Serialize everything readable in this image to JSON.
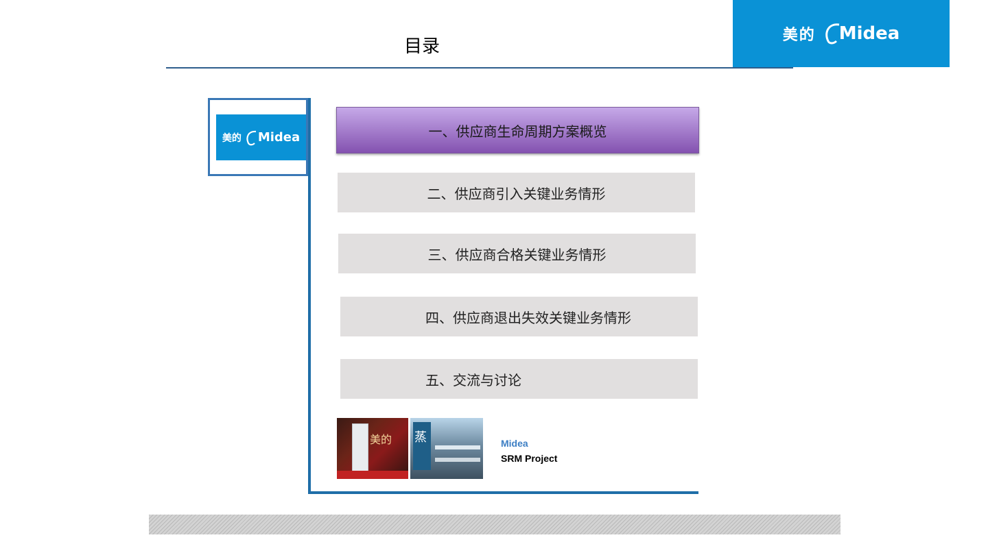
{
  "header": {
    "title": "目录",
    "brand_cn": "美的",
    "brand_en": "Midea",
    "brand_color": "#0a92d6"
  },
  "frame_logo": {
    "cn": "美的",
    "en": "Midea"
  },
  "menu": {
    "items": [
      {
        "label": "一、供应商生命周期方案概览",
        "active": true
      },
      {
        "label": "二、供应商引入关键业务情形",
        "active": false
      },
      {
        "label": "三、供应商合格关键业务情形",
        "active": false
      },
      {
        "label": "四、供应商退出失效关键业务情形",
        "active": false
      },
      {
        "label": "五、交流与讨论",
        "active": false
      }
    ]
  },
  "project": {
    "name": "Midea",
    "subtitle": "SRM Project"
  },
  "photos": {
    "left_text": "美的",
    "right_text": "蒸"
  }
}
